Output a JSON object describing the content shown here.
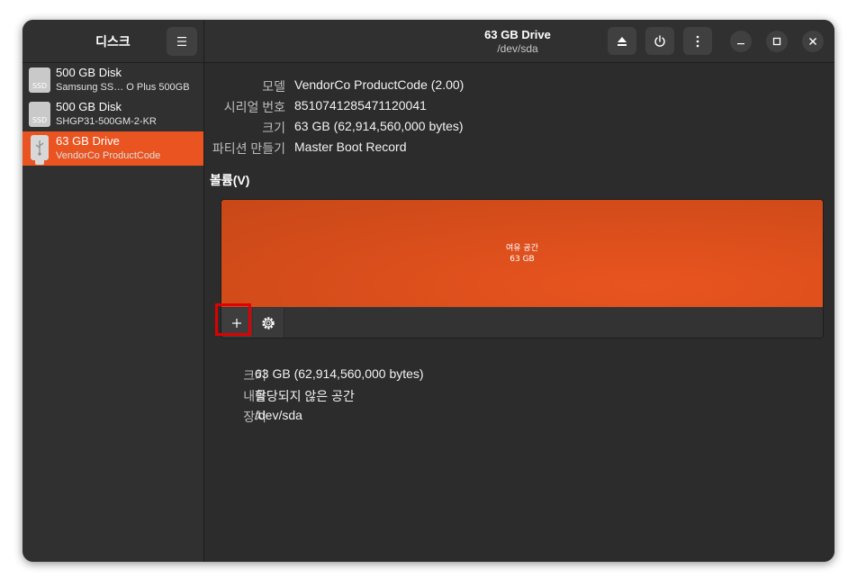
{
  "sidebar": {
    "app_title": "디스크",
    "items": [
      {
        "name": "500 GB Disk",
        "sub": "Samsung SS… O Plus 500GB",
        "icon_label": "SSD"
      },
      {
        "name": "500 GB Disk",
        "sub": "SHGP31-500GM-2-KR",
        "icon_label": "SSD"
      },
      {
        "name": "63 GB Drive",
        "sub": "VendorCo ProductCode",
        "selected": true
      }
    ]
  },
  "header": {
    "title": "63 GB Drive",
    "subtitle": "/dev/sda"
  },
  "drive_info": {
    "model_label": "모델",
    "model_value": "VendorCo ProductCode (2.00)",
    "serial_label": "시리얼 번호",
    "serial_value": "8510741285471120041",
    "size_label": "크기",
    "size_value": "63 GB (62,914,560,000 bytes)",
    "partitioning_label": "파티션 만들기",
    "partitioning_value": "Master Boot Record"
  },
  "volumes": {
    "section_title": "볼륨(V)",
    "partition_name": "여유 공간",
    "partition_size": "63 GB"
  },
  "volume_info": {
    "size_label": "크기",
    "size_value": "63 GB (62,914,560,000 bytes)",
    "contents_label": "내용",
    "contents_value": "할당되지 않은 공간",
    "device_label": "장치",
    "device_value": "/dev/sda"
  },
  "colors": {
    "accent": "#e95420",
    "highlight": "#e00000",
    "background": "#2c2c2c"
  },
  "icons": [
    "hamburger-menu-icon",
    "eject-icon",
    "power-icon",
    "kebab-menu-icon",
    "minimize-icon",
    "maximize-icon",
    "close-icon",
    "plus-icon",
    "gear-icon",
    "ssd-disk-icon",
    "usb-drive-icon"
  ]
}
